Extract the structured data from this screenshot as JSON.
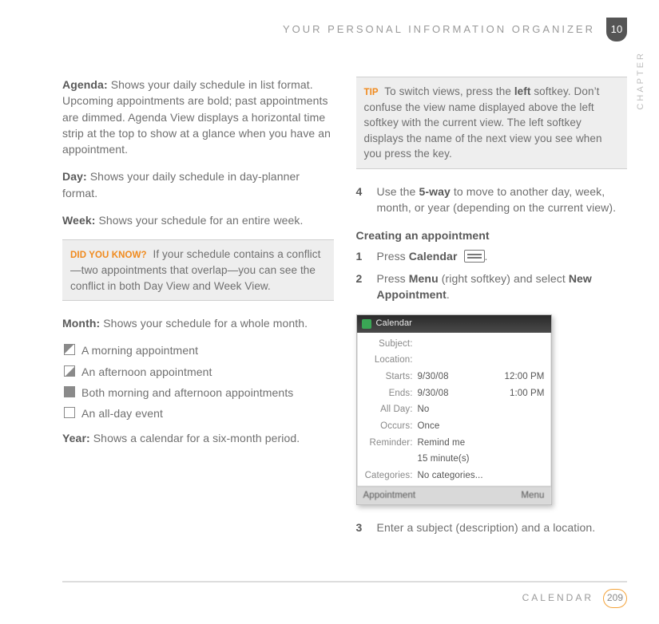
{
  "header": {
    "title": "YOUR PERSONAL INFORMATION ORGANIZER",
    "chapter_num": "10",
    "chapter_word": "CHAPTER"
  },
  "footer": {
    "section": "CALENDAR",
    "page": "209"
  },
  "left": {
    "agenda_label": "Agenda:",
    "agenda_text": " Shows your daily schedule in list format. Upcoming appointments are bold; past appointments are dimmed. Agenda View displays a horizontal time strip at the top to show at a glance when you have an appointment.",
    "day_label": "Day:",
    "day_text": " Shows your daily schedule in day-planner format.",
    "week_label": "Week:",
    "week_text": " Shows your schedule for an entire week.",
    "dyk_tag": "DID YOU KNOW?",
    "dyk_text": " If your schedule contains a conflict—two appointments that overlap—you can see the conflict in both Day View and Week View.",
    "month_label": "Month:",
    "month_text": " Shows your schedule for a whole month.",
    "icon_morning": "A morning appointment",
    "icon_afternoon": "An afternoon appointment",
    "icon_both": "Both morning and afternoon appointments",
    "icon_allday": "An all-day event",
    "year_label": "Year:",
    "year_text": " Shows a calendar for a six-month period."
  },
  "right": {
    "tip_tag": "TIP",
    "tip_a": " To switch views, press the ",
    "tip_bold": "left",
    "tip_b": " softkey. Don’t confuse the view name displayed above the left softkey with the current view. The left softkey displays the name of the next view you see when you press the key.",
    "step4_num": "4",
    "step4_a": "Use the ",
    "step4_bold": "5-way",
    "step4_b": " to move to another day, week, month, or year (depending on the current view).",
    "creating_heading": "Creating an appointment",
    "s1_num": "1",
    "s1_a": "Press ",
    "s1_bold": "Calendar",
    "s1_b": " ",
    "s1_c": ".",
    "s2_num": "2",
    "s2_a": "Press ",
    "s2_bold1": "Menu",
    "s2_b": " (right softkey) and select ",
    "s2_bold2": "New Appointment",
    "s2_c": ".",
    "s3_num": "3",
    "s3_text": "Enter a subject (description) and a location."
  },
  "device": {
    "title": "Calendar",
    "subject_lbl": "Subject:",
    "location_lbl": "Location:",
    "starts_lbl": "Starts:",
    "starts_val": "9/30/08",
    "starts_t": "12:00 PM",
    "ends_lbl": "Ends:",
    "ends_val": "9/30/08",
    "ends_t": "1:00 PM",
    "allday_lbl": "All Day:",
    "allday_val": "No",
    "occurs_lbl": "Occurs:",
    "occurs_val": "Once",
    "reminder_lbl": "Reminder:",
    "reminder_val": "Remind me",
    "reminder2": "15   minute(s)",
    "categories_lbl": "Categories:",
    "categories_val": "No categories...",
    "foot_left": "Appointment",
    "foot_right": "Menu"
  }
}
